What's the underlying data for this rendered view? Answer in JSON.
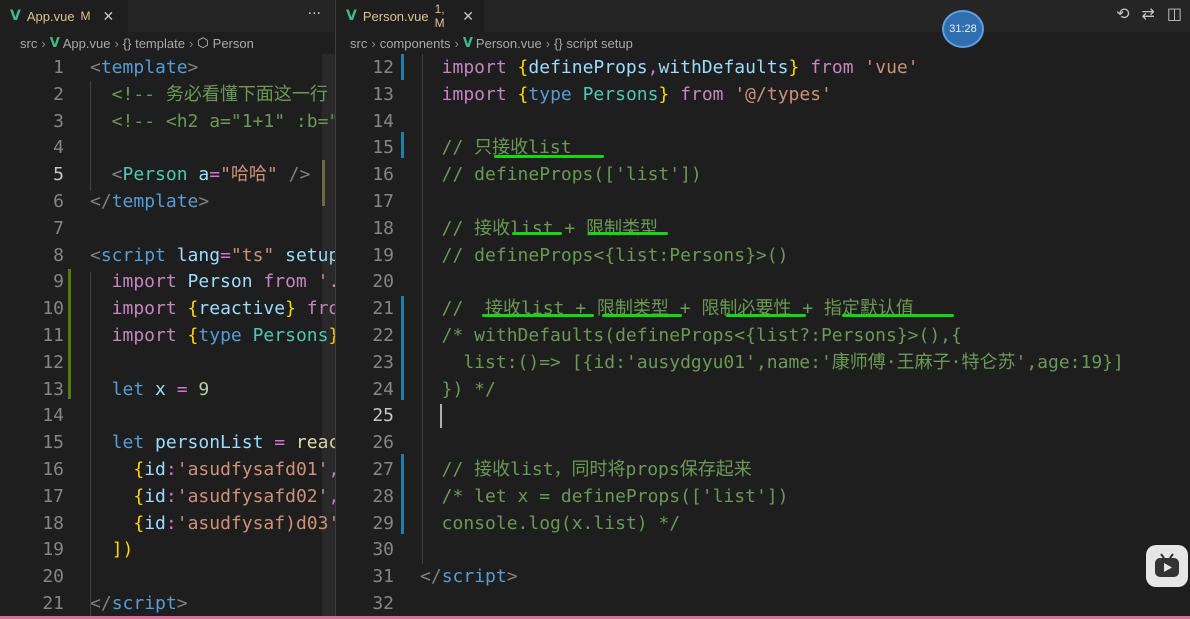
{
  "left": {
    "tab": {
      "title": "App.vue",
      "badge": "M"
    },
    "breadcrumb": [
      "src",
      "App.vue",
      "{} template",
      "Person"
    ],
    "lines": [
      {
        "n": "1",
        "tokens": [
          [
            "g",
            "<"
          ],
          [
            "t",
            "template"
          ],
          [
            "g",
            ">"
          ]
        ]
      },
      {
        "n": "2",
        "tokens": [
          [
            "c",
            "  <!-- 务必看懂下面这一行"
          ]
        ]
      },
      {
        "n": "3",
        "tokens": [
          [
            "c",
            "  <!-- <h2 a=\"1+1\" :b=\""
          ]
        ]
      },
      {
        "n": "4",
        "tokens": []
      },
      {
        "n": "5",
        "tokens": [
          [
            "g",
            "  <"
          ],
          [
            "cls",
            "Person"
          ],
          [
            "p",
            " "
          ],
          [
            "v",
            "a"
          ],
          [
            "p",
            "="
          ],
          [
            "s",
            "\"哈哈\""
          ],
          [
            "g",
            " />"
          ]
        ]
      },
      {
        "n": "6",
        "tokens": [
          [
            "g",
            "</"
          ],
          [
            "t",
            "template"
          ],
          [
            "g",
            ">"
          ]
        ]
      },
      {
        "n": "7",
        "tokens": []
      },
      {
        "n": "8",
        "tokens": [
          [
            "g",
            "<"
          ],
          [
            "t",
            "script"
          ],
          [
            "p",
            " "
          ],
          [
            "v",
            "lang"
          ],
          [
            "p",
            "="
          ],
          [
            "s",
            "\"ts\""
          ],
          [
            "p",
            " "
          ],
          [
            "v",
            "setup"
          ]
        ]
      },
      {
        "n": "9",
        "tokens": [
          [
            "k",
            "  import"
          ],
          [
            "p",
            " "
          ],
          [
            "v",
            "Person"
          ],
          [
            "p",
            " "
          ],
          [
            "k",
            "from"
          ],
          [
            "p",
            " "
          ],
          [
            "s",
            "'."
          ]
        ]
      },
      {
        "n": "10",
        "tokens": [
          [
            "k",
            "  import"
          ],
          [
            "p",
            " "
          ],
          [
            "y",
            "{"
          ],
          [
            "v",
            "reactive"
          ],
          [
            "y",
            "}"
          ],
          [
            "p",
            " "
          ],
          [
            "k",
            "from"
          ]
        ]
      },
      {
        "n": "11",
        "tokens": [
          [
            "k",
            "  import"
          ],
          [
            "p",
            " "
          ],
          [
            "y",
            "{"
          ],
          [
            "t",
            "type"
          ],
          [
            "p",
            " "
          ],
          [
            "cls",
            "Persons"
          ],
          [
            "y",
            "}"
          ]
        ]
      },
      {
        "n": "12",
        "tokens": []
      },
      {
        "n": "13",
        "tokens": [
          [
            "t",
            "  let"
          ],
          [
            "p",
            " "
          ],
          [
            "v",
            "x"
          ],
          [
            "p",
            " = "
          ],
          [
            "n",
            "9"
          ]
        ]
      },
      {
        "n": "14",
        "tokens": []
      },
      {
        "n": "15",
        "tokens": [
          [
            "t",
            "  let"
          ],
          [
            "p",
            " "
          ],
          [
            "v",
            "personList"
          ],
          [
            "p",
            " = "
          ],
          [
            "f",
            "reac"
          ]
        ]
      },
      {
        "n": "16",
        "tokens": [
          [
            "p",
            "    "
          ],
          [
            "y",
            "{"
          ],
          [
            "v",
            "id"
          ],
          [
            "p",
            ":"
          ],
          [
            "s",
            "'asudfysafd01'"
          ],
          [
            "p",
            ","
          ]
        ]
      },
      {
        "n": "17",
        "tokens": [
          [
            "p",
            "    "
          ],
          [
            "y",
            "{"
          ],
          [
            "v",
            "id"
          ],
          [
            "p",
            ":"
          ],
          [
            "s",
            "'asudfysafd02'"
          ],
          [
            "p",
            ","
          ]
        ]
      },
      {
        "n": "18",
        "tokens": [
          [
            "p",
            "    "
          ],
          [
            "y",
            "{"
          ],
          [
            "v",
            "id"
          ],
          [
            "p",
            ":"
          ],
          [
            "s",
            "'asudfysaf)d03'"
          ]
        ]
      },
      {
        "n": "19",
        "tokens": [
          [
            "p",
            "  "
          ],
          [
            "y",
            "])"
          ]
        ]
      },
      {
        "n": "20",
        "tokens": []
      },
      {
        "n": "21",
        "tokens": [
          [
            "g",
            "</"
          ],
          [
            "t",
            "script"
          ],
          [
            "g",
            ">"
          ]
        ]
      }
    ]
  },
  "right": {
    "tab": {
      "title": "Person.vue",
      "badge": "1, M"
    },
    "breadcrumb": [
      "src",
      "components",
      "Person.vue",
      "{} script setup"
    ],
    "timer": "31:28",
    "lines": [
      {
        "n": "12",
        "tokens": [
          [
            "k",
            "  import"
          ],
          [
            "p",
            " "
          ],
          [
            "y",
            "{"
          ],
          [
            "v",
            "defineProps"
          ],
          [
            "p",
            ","
          ],
          [
            "v",
            "withDefaults"
          ],
          [
            "y",
            "}"
          ],
          [
            "p",
            " "
          ],
          [
            "k",
            "from"
          ],
          [
            "p",
            " "
          ],
          [
            "s",
            "'vue'"
          ]
        ]
      },
      {
        "n": "13",
        "tokens": [
          [
            "k",
            "  import"
          ],
          [
            "p",
            " "
          ],
          [
            "y",
            "{"
          ],
          [
            "t",
            "type"
          ],
          [
            "p",
            " "
          ],
          [
            "cls",
            "Persons"
          ],
          [
            "y",
            "}"
          ],
          [
            "p",
            " "
          ],
          [
            "k",
            "from"
          ],
          [
            "p",
            " "
          ],
          [
            "s",
            "'@/types'"
          ]
        ]
      },
      {
        "n": "14",
        "tokens": []
      },
      {
        "n": "15",
        "tokens": [
          [
            "c",
            "  // 只接收list"
          ]
        ]
      },
      {
        "n": "16",
        "tokens": [
          [
            "c",
            "  // defineProps(['list'])"
          ]
        ]
      },
      {
        "n": "17",
        "tokens": []
      },
      {
        "n": "18",
        "tokens": [
          [
            "c",
            "  // 接收list + 限制类型"
          ]
        ]
      },
      {
        "n": "19",
        "tokens": [
          [
            "c",
            "  // defineProps<{list:Persons}>()"
          ]
        ]
      },
      {
        "n": "20",
        "tokens": []
      },
      {
        "n": "21",
        "tokens": [
          [
            "c",
            "  //  接收list + 限制类型 + 限制必要性 + 指定默认值"
          ]
        ]
      },
      {
        "n": "22",
        "tokens": [
          [
            "c",
            "  /* withDefaults(defineProps<{list?:Persons}>(),{"
          ]
        ]
      },
      {
        "n": "23",
        "tokens": [
          [
            "c",
            "    list:()=> [{id:'ausydgyu01',name:'康师傅·王麻子·特仑苏',age:19}]"
          ]
        ]
      },
      {
        "n": "24",
        "tokens": [
          [
            "c",
            "  }) */"
          ]
        ]
      },
      {
        "n": "25",
        "tokens": []
      },
      {
        "n": "26",
        "tokens": []
      },
      {
        "n": "27",
        "tokens": [
          [
            "c",
            "  // 接收list，同时将props保存起来"
          ]
        ]
      },
      {
        "n": "28",
        "tokens": [
          [
            "c",
            "  /* let x = defineProps(['list'])"
          ]
        ]
      },
      {
        "n": "29",
        "tokens": [
          [
            "c",
            "  console.log(x.list) */"
          ]
        ]
      },
      {
        "n": "30",
        "tokens": []
      },
      {
        "n": "31",
        "tokens": [
          [
            "g",
            "</"
          ],
          [
            "t",
            "script"
          ],
          [
            "g",
            ">"
          ]
        ]
      },
      {
        "n": "32",
        "tokens": []
      }
    ]
  },
  "colors": {
    "vue_green": "#42b883",
    "modified": "#e2c08d",
    "underline": "#12d912"
  }
}
